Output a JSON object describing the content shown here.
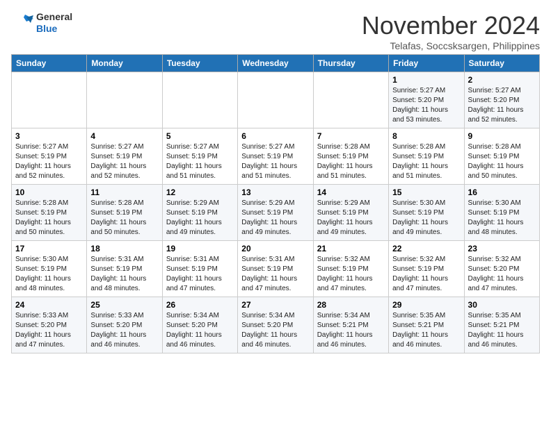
{
  "logo": {
    "line1": "General",
    "line2": "Blue"
  },
  "header": {
    "month": "November 2024",
    "location": "Telafas, Soccsksargen, Philippines"
  },
  "weekdays": [
    "Sunday",
    "Monday",
    "Tuesday",
    "Wednesday",
    "Thursday",
    "Friday",
    "Saturday"
  ],
  "weeks": [
    [
      {
        "day": "",
        "info": ""
      },
      {
        "day": "",
        "info": ""
      },
      {
        "day": "",
        "info": ""
      },
      {
        "day": "",
        "info": ""
      },
      {
        "day": "",
        "info": ""
      },
      {
        "day": "1",
        "info": "Sunrise: 5:27 AM\nSunset: 5:20 PM\nDaylight: 11 hours\nand 53 minutes."
      },
      {
        "day": "2",
        "info": "Sunrise: 5:27 AM\nSunset: 5:20 PM\nDaylight: 11 hours\nand 52 minutes."
      }
    ],
    [
      {
        "day": "3",
        "info": "Sunrise: 5:27 AM\nSunset: 5:19 PM\nDaylight: 11 hours\nand 52 minutes."
      },
      {
        "day": "4",
        "info": "Sunrise: 5:27 AM\nSunset: 5:19 PM\nDaylight: 11 hours\nand 52 minutes."
      },
      {
        "day": "5",
        "info": "Sunrise: 5:27 AM\nSunset: 5:19 PM\nDaylight: 11 hours\nand 51 minutes."
      },
      {
        "day": "6",
        "info": "Sunrise: 5:27 AM\nSunset: 5:19 PM\nDaylight: 11 hours\nand 51 minutes."
      },
      {
        "day": "7",
        "info": "Sunrise: 5:28 AM\nSunset: 5:19 PM\nDaylight: 11 hours\nand 51 minutes."
      },
      {
        "day": "8",
        "info": "Sunrise: 5:28 AM\nSunset: 5:19 PM\nDaylight: 11 hours\nand 51 minutes."
      },
      {
        "day": "9",
        "info": "Sunrise: 5:28 AM\nSunset: 5:19 PM\nDaylight: 11 hours\nand 50 minutes."
      }
    ],
    [
      {
        "day": "10",
        "info": "Sunrise: 5:28 AM\nSunset: 5:19 PM\nDaylight: 11 hours\nand 50 minutes."
      },
      {
        "day": "11",
        "info": "Sunrise: 5:28 AM\nSunset: 5:19 PM\nDaylight: 11 hours\nand 50 minutes."
      },
      {
        "day": "12",
        "info": "Sunrise: 5:29 AM\nSunset: 5:19 PM\nDaylight: 11 hours\nand 49 minutes."
      },
      {
        "day": "13",
        "info": "Sunrise: 5:29 AM\nSunset: 5:19 PM\nDaylight: 11 hours\nand 49 minutes."
      },
      {
        "day": "14",
        "info": "Sunrise: 5:29 AM\nSunset: 5:19 PM\nDaylight: 11 hours\nand 49 minutes."
      },
      {
        "day": "15",
        "info": "Sunrise: 5:30 AM\nSunset: 5:19 PM\nDaylight: 11 hours\nand 49 minutes."
      },
      {
        "day": "16",
        "info": "Sunrise: 5:30 AM\nSunset: 5:19 PM\nDaylight: 11 hours\nand 48 minutes."
      }
    ],
    [
      {
        "day": "17",
        "info": "Sunrise: 5:30 AM\nSunset: 5:19 PM\nDaylight: 11 hours\nand 48 minutes."
      },
      {
        "day": "18",
        "info": "Sunrise: 5:31 AM\nSunset: 5:19 PM\nDaylight: 11 hours\nand 48 minutes."
      },
      {
        "day": "19",
        "info": "Sunrise: 5:31 AM\nSunset: 5:19 PM\nDaylight: 11 hours\nand 47 minutes."
      },
      {
        "day": "20",
        "info": "Sunrise: 5:31 AM\nSunset: 5:19 PM\nDaylight: 11 hours\nand 47 minutes."
      },
      {
        "day": "21",
        "info": "Sunrise: 5:32 AM\nSunset: 5:19 PM\nDaylight: 11 hours\nand 47 minutes."
      },
      {
        "day": "22",
        "info": "Sunrise: 5:32 AM\nSunset: 5:19 PM\nDaylight: 11 hours\nand 47 minutes."
      },
      {
        "day": "23",
        "info": "Sunrise: 5:32 AM\nSunset: 5:20 PM\nDaylight: 11 hours\nand 47 minutes."
      }
    ],
    [
      {
        "day": "24",
        "info": "Sunrise: 5:33 AM\nSunset: 5:20 PM\nDaylight: 11 hours\nand 47 minutes."
      },
      {
        "day": "25",
        "info": "Sunrise: 5:33 AM\nSunset: 5:20 PM\nDaylight: 11 hours\nand 46 minutes."
      },
      {
        "day": "26",
        "info": "Sunrise: 5:34 AM\nSunset: 5:20 PM\nDaylight: 11 hours\nand 46 minutes."
      },
      {
        "day": "27",
        "info": "Sunrise: 5:34 AM\nSunset: 5:20 PM\nDaylight: 11 hours\nand 46 minutes."
      },
      {
        "day": "28",
        "info": "Sunrise: 5:34 AM\nSunset: 5:21 PM\nDaylight: 11 hours\nand 46 minutes."
      },
      {
        "day": "29",
        "info": "Sunrise: 5:35 AM\nSunset: 5:21 PM\nDaylight: 11 hours\nand 46 minutes."
      },
      {
        "day": "30",
        "info": "Sunrise: 5:35 AM\nSunset: 5:21 PM\nDaylight: 11 hours\nand 46 minutes."
      }
    ]
  ]
}
